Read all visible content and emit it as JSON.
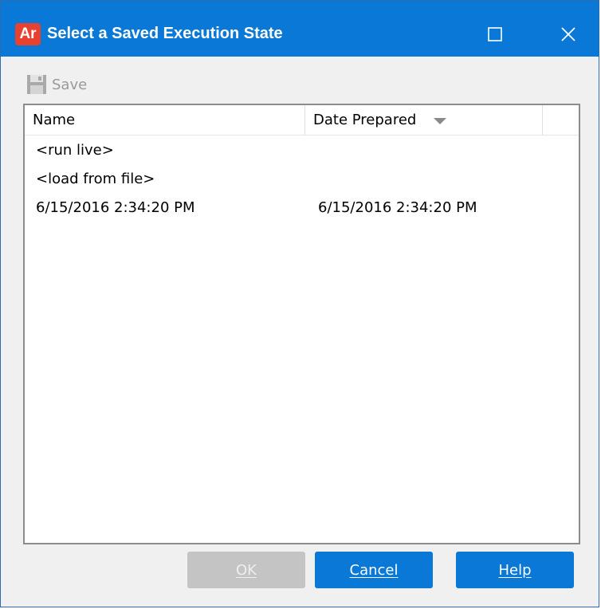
{
  "window": {
    "app_icon_text": "Ar",
    "title": "Select a Saved Execution State",
    "maximize_icon": "maximize-icon",
    "close_icon": "close-icon",
    "accent_color": "#0a78d7"
  },
  "toolbar": {
    "save_label": "Save",
    "save_icon": "floppy-disk-icon",
    "save_enabled": false
  },
  "list": {
    "columns": [
      "Name",
      "Date Prepared"
    ],
    "sort_column": "Date Prepared",
    "sort_direction": "descending",
    "rows": [
      {
        "name": "<run live>",
        "date": ""
      },
      {
        "name": "<load from file>",
        "date": ""
      },
      {
        "name": "6/15/2016 2:34:20 PM",
        "date": "6/15/2016 2:34:20 PM"
      }
    ]
  },
  "buttons": {
    "ok": {
      "label": "OK",
      "enabled": false
    },
    "cancel": {
      "label": "Cancel",
      "enabled": true
    },
    "help": {
      "label": "Help",
      "enabled": true
    }
  }
}
